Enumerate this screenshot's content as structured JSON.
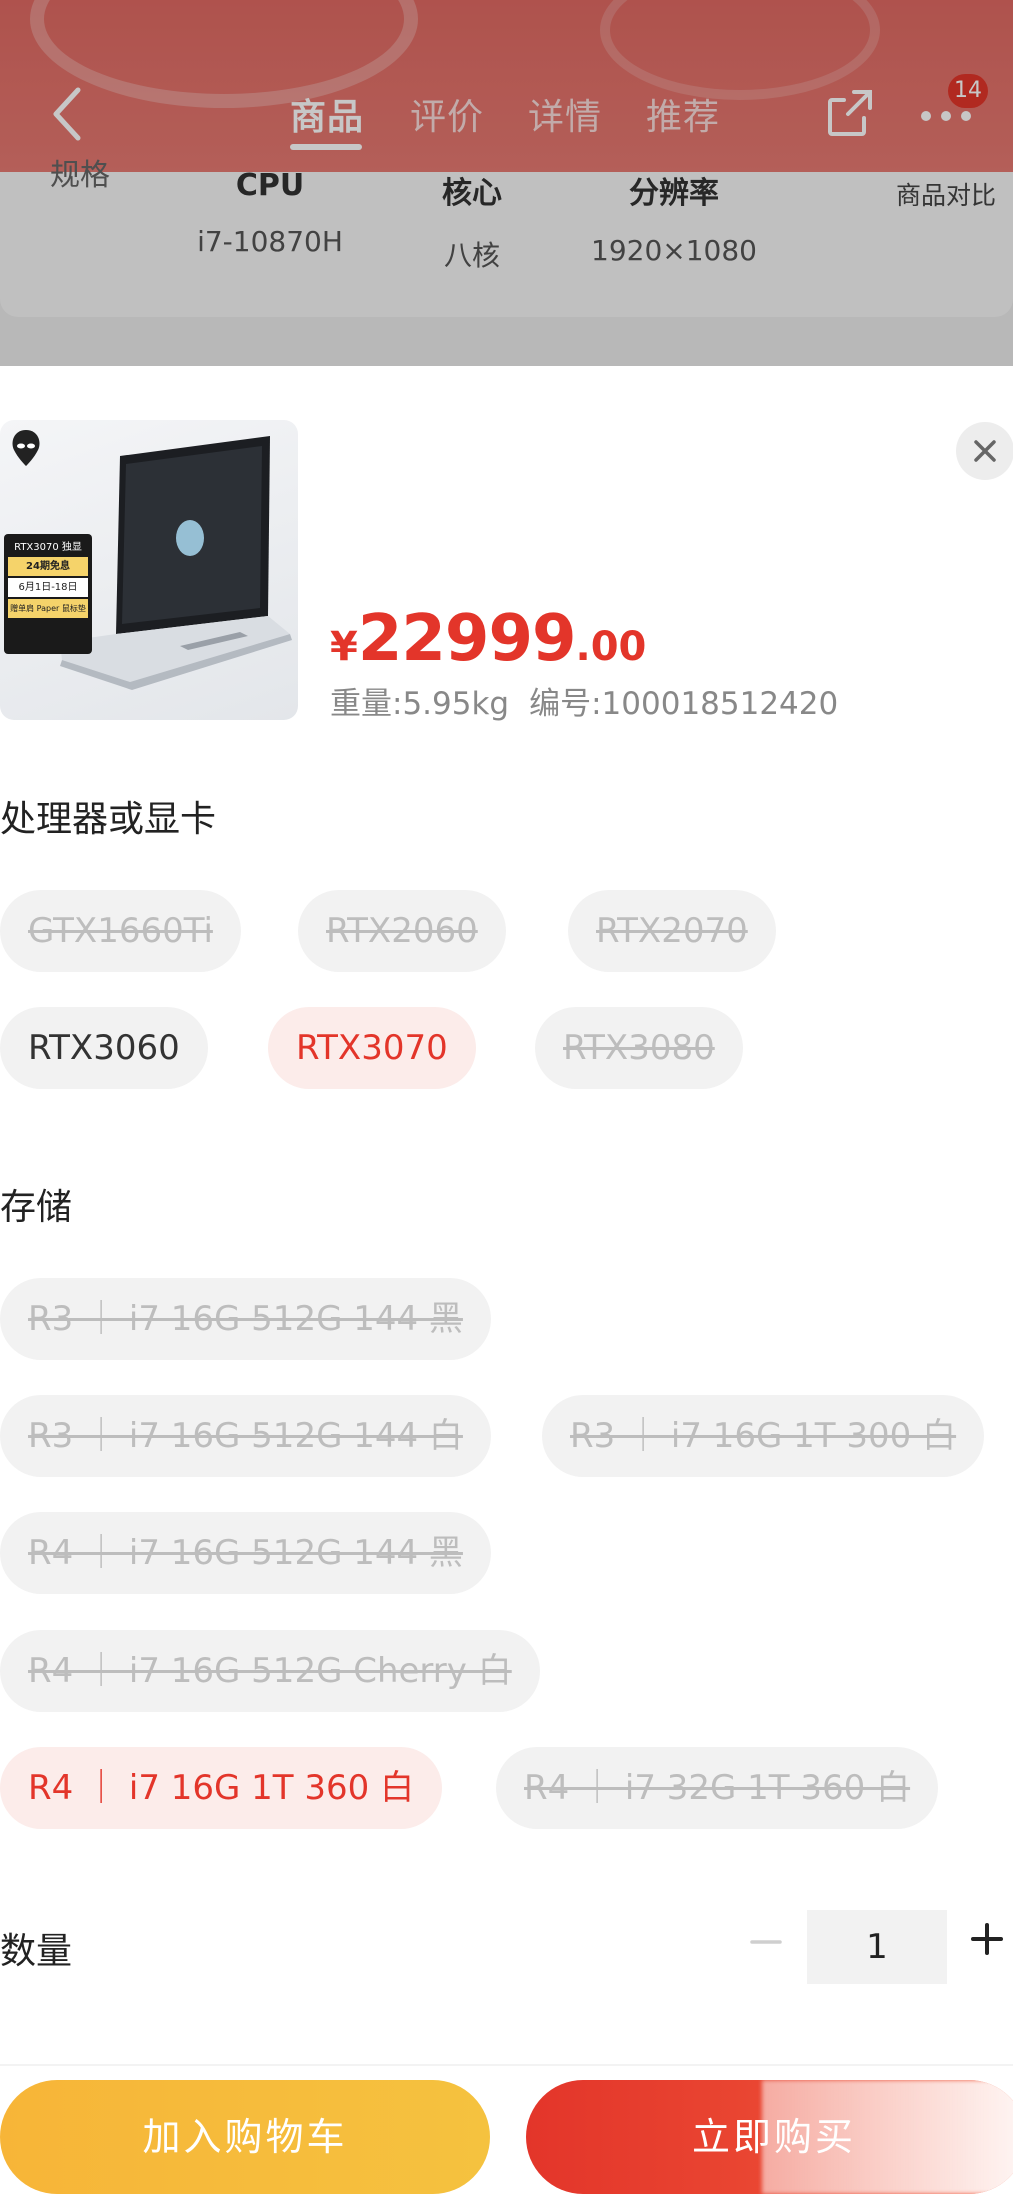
{
  "nav": {
    "tabs": [
      "商品",
      "评价",
      "详情",
      "推荐"
    ],
    "active_tab": 0,
    "badge_count": "14"
  },
  "spec_strip": {
    "label": "规格",
    "columns": [
      {
        "header": "CPU",
        "value": "i7-10870H"
      },
      {
        "header": "核心",
        "value": "八核"
      },
      {
        "header": "分辨率",
        "value": "1920×1080"
      }
    ],
    "compare_label": "商品对比"
  },
  "product": {
    "thumb_badges": [
      "RTX3070 独显",
      "24期免息",
      "6月1日-18日",
      "赠单肩 Paper 鼠标垫"
    ],
    "price_currency": "¥",
    "price_integer": "22999",
    "price_decimal": ".00",
    "weight": "重量:5.95kg",
    "sku": "编号:100018512420"
  },
  "gpu_section": {
    "title": "处理器或显卡",
    "options": [
      {
        "label": "GTX1660Ti",
        "state": "disabled"
      },
      {
        "label": "RTX2060",
        "state": "disabled"
      },
      {
        "label": "RTX2070",
        "state": "disabled"
      },
      {
        "label": "RTX3060",
        "state": "available"
      },
      {
        "label": "RTX3070",
        "state": "selected"
      },
      {
        "label": "RTX3080",
        "state": "disabled"
      }
    ]
  },
  "storage_section": {
    "title": "存储",
    "options": [
      {
        "label": "R3 ｜ i7 16G 512G 144 黑",
        "state": "disabled"
      },
      {
        "label": "R3 ｜ i7 16G 512G 144 白",
        "state": "disabled"
      },
      {
        "label": "R3 ｜ i7 16G 1T 300 白",
        "state": "disabled"
      },
      {
        "label": "R4 ｜ i7 16G 512G 144 黑",
        "state": "disabled"
      },
      {
        "label": "R4 ｜ i7 16G 512G Cherry 白",
        "state": "disabled"
      },
      {
        "label": "R4 ｜ i7 16G 1T 360 白",
        "state": "selected"
      },
      {
        "label": "R4 ｜ i7 32G 1T 360 白",
        "state": "disabled"
      }
    ]
  },
  "quantity": {
    "title": "数量",
    "value": "1"
  },
  "actions": {
    "add_to_cart": "加入购物车",
    "buy_now": "立即购买"
  },
  "colors": {
    "accent_red": "#e3352a",
    "cart_yellow": "#f7b538",
    "selected_bg": "#fcecea",
    "chip_bg": "#f2f2f2"
  }
}
